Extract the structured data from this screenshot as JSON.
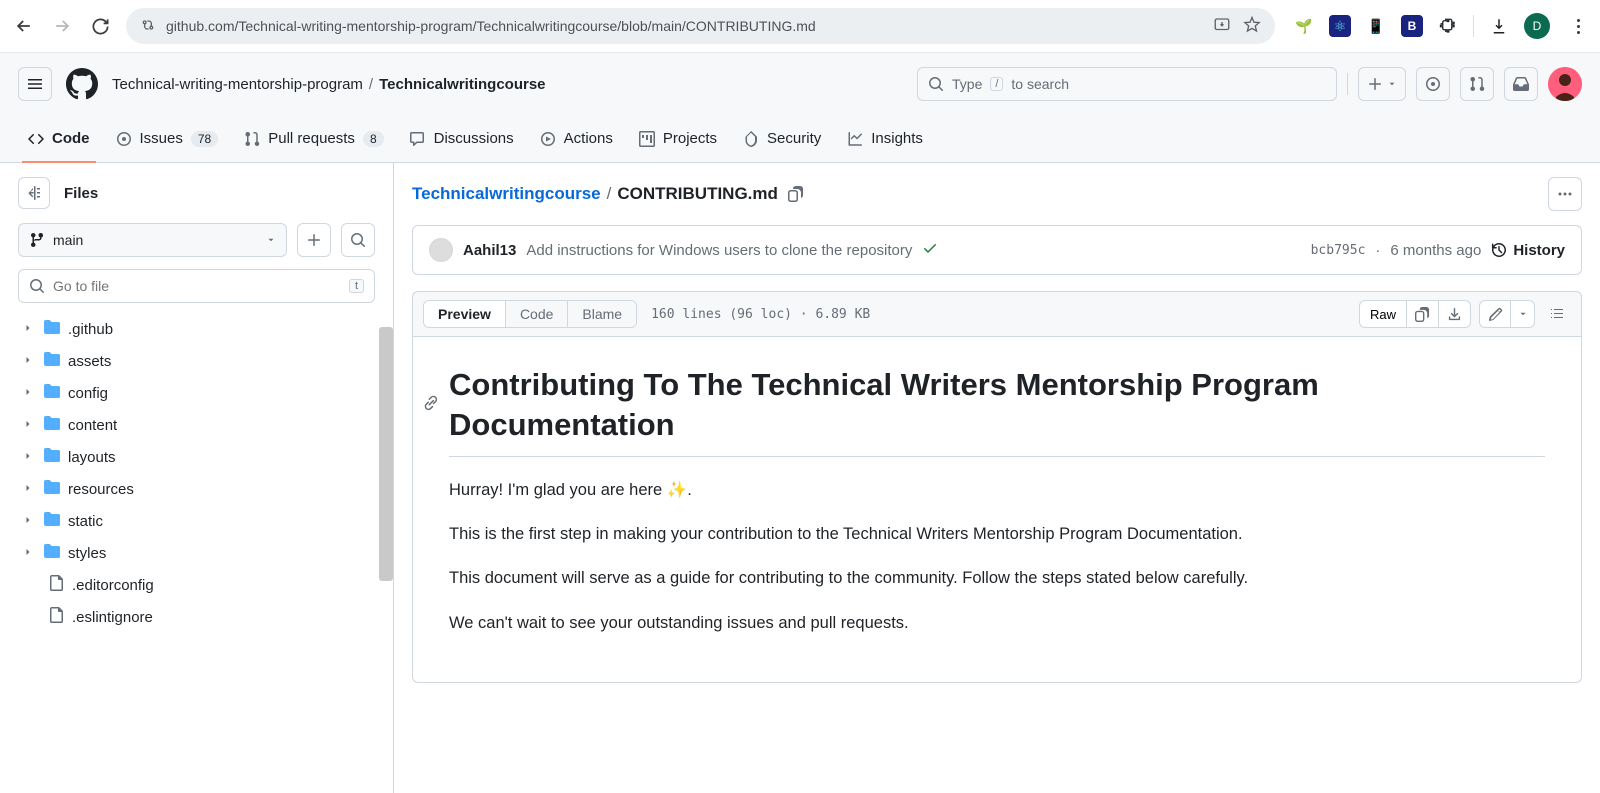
{
  "browser": {
    "url": "github.com/Technical-writing-mentorship-program/Technicalwritingcourse/blob/main/CONTRIBUTING.md",
    "avatar_letter": "D"
  },
  "gh_header": {
    "owner": "Technical-writing-mentorship-program",
    "repo": "Technicalwritingcourse",
    "search_prefix": "Type",
    "search_kbd": "/",
    "search_suffix": "to search"
  },
  "tabs": {
    "code": "Code",
    "issues": "Issues",
    "issues_count": "78",
    "pulls": "Pull requests",
    "pulls_count": "8",
    "discussions": "Discussions",
    "actions": "Actions",
    "projects": "Projects",
    "security": "Security",
    "insights": "Insights"
  },
  "sidebar": {
    "title": "Files",
    "branch": "main",
    "filter_placeholder": "Go to file",
    "filter_kbd": "t",
    "tree": [
      {
        "name": ".github",
        "type": "dir"
      },
      {
        "name": "assets",
        "type": "dir"
      },
      {
        "name": "config",
        "type": "dir"
      },
      {
        "name": "content",
        "type": "dir"
      },
      {
        "name": "layouts",
        "type": "dir"
      },
      {
        "name": "resources",
        "type": "dir"
      },
      {
        "name": "static",
        "type": "dir"
      },
      {
        "name": "styles",
        "type": "dir"
      },
      {
        "name": ".editorconfig",
        "type": "file"
      },
      {
        "name": ".eslintignore",
        "type": "file"
      }
    ]
  },
  "content": {
    "crumb_repo": "Technicalwritingcourse",
    "crumb_file": "CONTRIBUTING.md",
    "commit": {
      "author": "Aahil13",
      "message": "Add instructions for Windows users to clone the repository",
      "sha": "bcb795c",
      "age": "6 months ago",
      "history": "History"
    },
    "toolbar": {
      "preview": "Preview",
      "code": "Code",
      "blame": "Blame",
      "stats": "160 lines (96 loc) · 6.89 KB",
      "raw": "Raw"
    },
    "markdown": {
      "h1": "Contributing To The Technical Writers Mentorship Program Documentation",
      "p1": "Hurray! I'm glad you are here ✨.",
      "p2": "This is the first step in making your contribution to the Technical Writers Mentorship Program Documentation.",
      "p3": "This document will serve as a guide for contributing to the community. Follow the steps stated below carefully.",
      "p4": "We can't wait to see your outstanding issues and pull requests."
    }
  }
}
